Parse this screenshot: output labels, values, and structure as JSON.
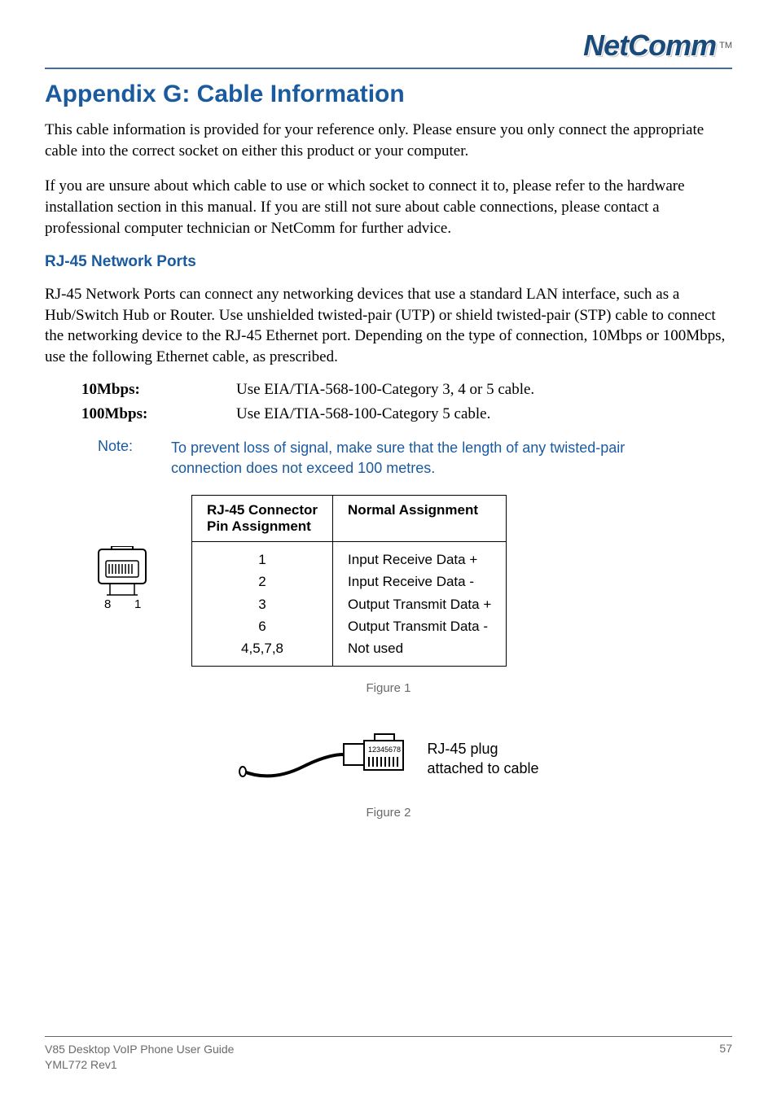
{
  "brand": {
    "name": "NetComm",
    "tm": "TM"
  },
  "title": "Appendix G: Cable Information",
  "para1": "This cable information is provided for your reference only.  Please ensure you only connect the appropriate cable into the correct socket on either this product or your computer.",
  "para2": "If you are unsure about which cable to use or which socket to connect it to, please refer to the hardware installation section in this manual. If you are still not sure about cable connections, please contact a professional computer technician or NetComm for further advice.",
  "section1": "RJ-45 Network Ports",
  "para3": "RJ-45 Network Ports can connect any networking devices that use a standard LAN interface, such as a Hub/Switch Hub or Router. Use unshielded twisted-pair (UTP) or shield twisted-pair (STP) cable to connect the networking device to the RJ-45 Ethernet port.   Depending on the type of connection, 10Mbps or 100Mbps, use the following Ethernet cable, as prescribed.",
  "specs": [
    {
      "label": "10Mbps:",
      "value": "Use EIA/TIA-568-100-Category 3, 4 or 5 cable."
    },
    {
      "label": "100Mbps:",
      "value": "Use EIA/TIA-568-100-Category 5 cable."
    }
  ],
  "note": {
    "label": "Note:",
    "body": "To prevent loss of signal, make sure that the length of any twisted-pair connection does not exceed 100 metres."
  },
  "connector_labels": {
    "left": "8",
    "right": "1"
  },
  "pin_table": {
    "header1_line1": "RJ-45 Connector",
    "header1_line2": "Pin Assignment",
    "header2": "Normal Assignment",
    "pins": [
      "1",
      "2",
      "3",
      "6",
      "4,5,7,8"
    ],
    "assign": [
      "Input Receive Data +",
      "Input Receive Data -",
      "Output Transmit Data +",
      "Output Transmit Data -",
      "Not used"
    ]
  },
  "figure1": "Figure 1",
  "plug_label_line1": "RJ-45 plug",
  "plug_label_line2": "attached to cable",
  "plug_pins": "12345678",
  "figure2": "Figure 2",
  "footer": {
    "guide": "V85 Desktop VoIP Phone User Guide",
    "rev": "YML772 Rev1",
    "page": "57"
  }
}
